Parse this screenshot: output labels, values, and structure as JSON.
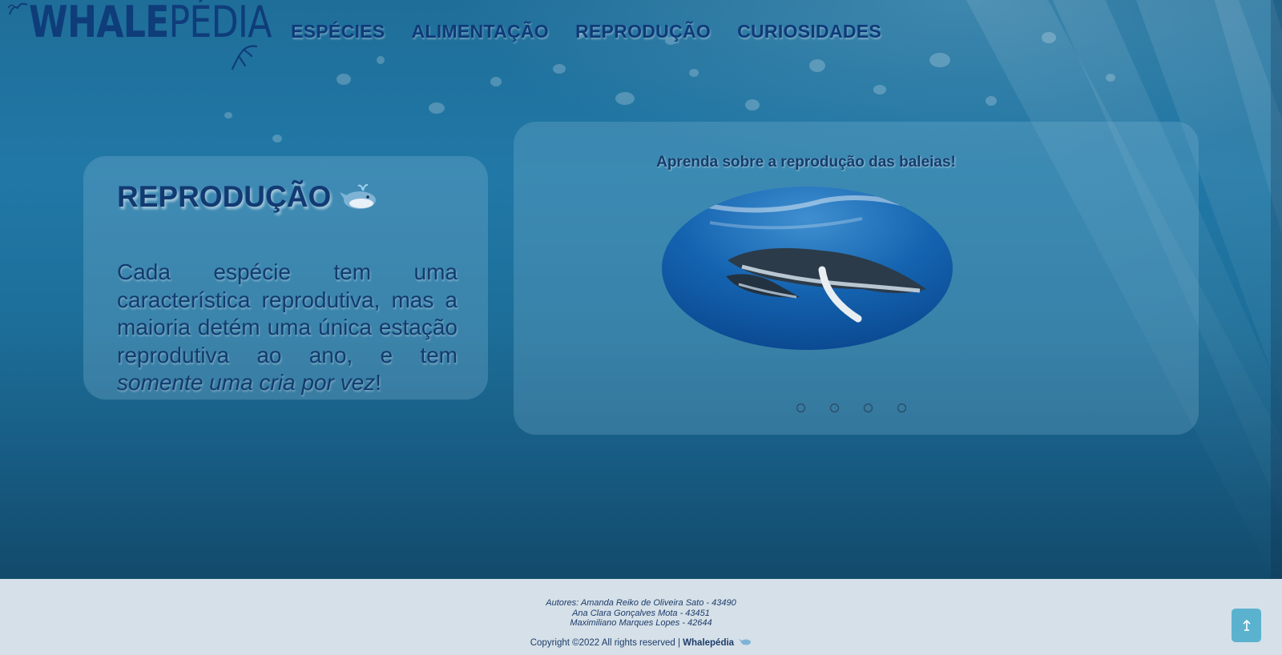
{
  "header": {
    "logo_bold": "WHALE",
    "logo_light": "PÉDIA",
    "nav": [
      {
        "label": "ESPÉCIES"
      },
      {
        "label": "ALIMENTAÇÃO"
      },
      {
        "label": "REPRODUÇÃO"
      },
      {
        "label": "CURIOSIDADES"
      }
    ]
  },
  "main": {
    "heading": "REPRODUÇÃO",
    "heading_icon": "whale-emoji-icon",
    "text_plain": "Cada espécie tem uma característica reprodutiva, mas a maioria detém uma única estação reprodutiva ao ano, e tem ",
    "text_emphasis": "somente uma cria por vez",
    "text_end": "!"
  },
  "carousel": {
    "caption": "Aprenda sobre a reprodução das baleias!",
    "slide_count": 4,
    "active_slide": 1
  },
  "footer": {
    "author_1": "Autores: Amanda Reiko de Oliveira Sato - 43490",
    "author_2": "Ana Clara Gonçalves Mota - 43451",
    "author_3": "Maximiliano Marques Lopes - 42644",
    "copyright_text": "Copyright ©2022 All rights reserved | ",
    "copyright_brand": "Whalepédia",
    "scroll_top_icon": "arrow-up-icon"
  },
  "colors": {
    "brand_navy": "#0f3a78",
    "ocean": "#1f6e99",
    "footer_bg": "#d5e0e8",
    "scroll_button": "#5bb2cf"
  }
}
